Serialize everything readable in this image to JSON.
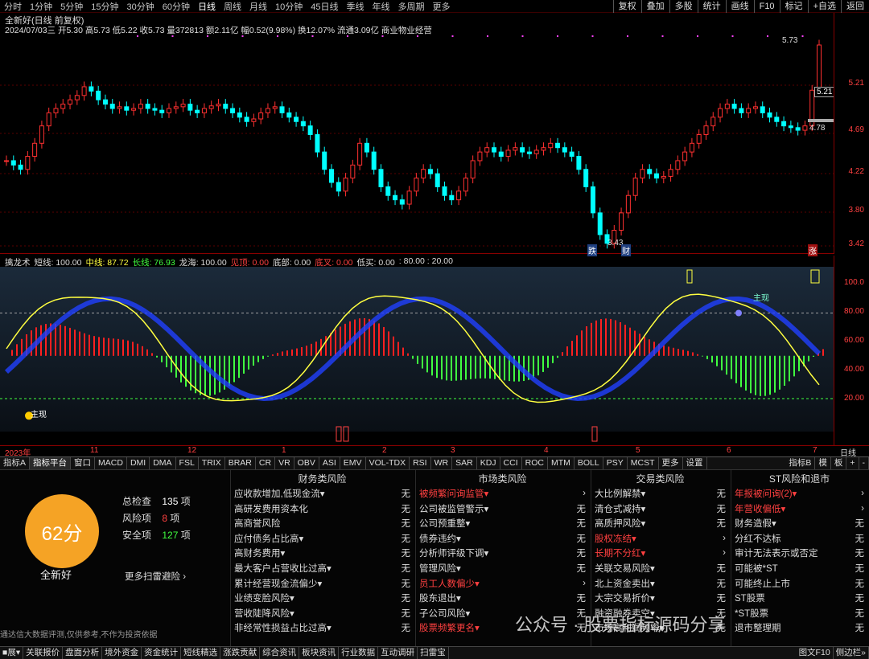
{
  "period_bar": {
    "items": [
      "分时",
      "1分钟",
      "5分钟",
      "15分钟",
      "30分钟",
      "60分钟",
      "日线",
      "周线",
      "月线",
      "10分钟",
      "45日线",
      "季线",
      "年线",
      "多周期",
      "更多"
    ],
    "active_index": 6,
    "right_buttons": [
      "复权",
      "叠加",
      "多股",
      "统计",
      "画线",
      "F10",
      "标记",
      "+自选",
      "返回"
    ]
  },
  "main_title": {
    "name": "全新好(日线 前复权)",
    "quote_line": "2024/07/03三 开5.30 高5.73 低5.22 收5.73 量372813 额2.11亿 幅0.52(9.98%) 换12.07% 流通3.09亿 商业物业经营",
    "price_high_label": "5.73",
    "price_last_label": "5.21",
    "price_mark_label": "4.78",
    "price_low_label": "3.43",
    "ma_tag": "财",
    "low_tag": "跌",
    "zhang_tag": "涨"
  },
  "main_yaxis": [
    "5.21",
    "4.69",
    "4.22",
    "3.80",
    "3.42"
  ],
  "ind_title": {
    "name": "擒龙术",
    "short": "短线: 100.00",
    "mid": "中线: 87.72",
    "long": "长线: 76.93",
    "dragon": "龙海: 100.00",
    "see_top": "见顶: 0.00",
    "bottom": "底部: 0.00",
    "bottom_cross": "底叉: 0.00",
    "low_buy": "低买: 0.00",
    "levels": ": 80.00 : 20.00"
  },
  "ind_labels": {
    "start": "主现",
    "mark2": "主现"
  },
  "ind_yaxis": [
    "100.0",
    "80.00",
    "60.00",
    "40.00",
    "20.00"
  ],
  "date_axis": [
    "2023年",
    "11",
    "12",
    "1",
    "2",
    "3",
    "4",
    "5",
    "6",
    "7",
    "日线"
  ],
  "tabs": [
    "指标A",
    "指标平台",
    "窗口",
    "MACD",
    "DMI",
    "DMA",
    "FSL",
    "TRIX",
    "BRAR",
    "CR",
    "VR",
    "OBV",
    "ASI",
    "EMV",
    "VOL-TDX",
    "RSI",
    "WR",
    "SAR",
    "KDJ",
    "CCI",
    "ROC",
    "MTM",
    "BOLL",
    "PSY",
    "MCST",
    "更多",
    "设置"
  ],
  "tabs_right": [
    "指标B",
    "模",
    "板",
    "+",
    "-"
  ],
  "scan": {
    "score": "62分",
    "stock_name": "全新好",
    "total_label": "总检查",
    "total_value": "135",
    "risk_label": "风险项",
    "risk_value": "8",
    "safe_label": "安全项",
    "safe_value": "127",
    "unit": "项",
    "more": "更多扫雷避险 ›",
    "disclaimer": "通达信大数据评测,仅供参考,不作为投资依据"
  },
  "columns": [
    {
      "title": "财务类风险",
      "rows": [
        {
          "label": "应收款增加,低现金流▾",
          "val": "无",
          "warn": false
        },
        {
          "label": "高研发费用资本化",
          "val": "无",
          "warn": false
        },
        {
          "label": "高商誉风险",
          "val": "无",
          "warn": false
        },
        {
          "label": "应付债务占比高▾",
          "val": "无",
          "warn": false
        },
        {
          "label": "高财务费用▾",
          "val": "无",
          "warn": false
        },
        {
          "label": "最大客户占营收比过高▾",
          "val": "无",
          "warn": false
        },
        {
          "label": "累计经营现金流偏少▾",
          "val": "无",
          "warn": false
        },
        {
          "label": "业绩变脸风险▾",
          "val": "无",
          "warn": false
        },
        {
          "label": "营收陡降风险▾",
          "val": "无",
          "warn": false
        },
        {
          "label": "非经常性损益占比过高▾",
          "val": "无",
          "warn": false
        }
      ]
    },
    {
      "title": "市场类风险",
      "rows": [
        {
          "label": "被频繁问询监管▾",
          "val": "›",
          "warn": true
        },
        {
          "label": "公司被监管警示▾",
          "val": "无",
          "warn": false
        },
        {
          "label": "公司预重整▾",
          "val": "无",
          "warn": false
        },
        {
          "label": "债券违约▾",
          "val": "无",
          "warn": false
        },
        {
          "label": "分析师评级下调▾",
          "val": "无",
          "warn": false
        },
        {
          "label": "管理风险▾",
          "val": "无",
          "warn": false
        },
        {
          "label": "员工人数偏少▾",
          "val": "›",
          "warn": true
        },
        {
          "label": "股东退出▾",
          "val": "无",
          "warn": false
        },
        {
          "label": "子公司风险▾",
          "val": "无",
          "warn": false
        },
        {
          "label": "股票频繁更名▾",
          "val": "无",
          "warn": true
        }
      ]
    },
    {
      "title": "交易类风险",
      "rows": [
        {
          "label": "大比例解禁▾",
          "val": "无",
          "warn": false
        },
        {
          "label": "清仓式减持▾",
          "val": "无",
          "warn": false
        },
        {
          "label": "高质押风险▾",
          "val": "无",
          "warn": false
        },
        {
          "label": "股权冻结▾",
          "val": "›",
          "warn": true
        },
        {
          "label": "长期不分红▾",
          "val": "›",
          "warn": true
        },
        {
          "label": "关联交易风险▾",
          "val": "无",
          "warn": false
        },
        {
          "label": "北上资金卖出▾",
          "val": "无",
          "warn": false
        },
        {
          "label": "大宗交易折价▾",
          "val": "无",
          "warn": false
        },
        {
          "label": "融资融券卖空▾",
          "val": "无",
          "warn": false
        },
        {
          "label": "市场高利润频率▾",
          "val": "无",
          "warn": false
        }
      ]
    },
    {
      "title": "ST风险和退市",
      "rows": [
        {
          "label": "年报被问询(2)▾",
          "val": "›",
          "warn": true
        },
        {
          "label": "年营收偏低▾",
          "val": "›",
          "warn": true
        },
        {
          "label": "财务造假▾",
          "val": "无",
          "warn": false
        },
        {
          "label": "分红不达标",
          "val": "无",
          "warn": false
        },
        {
          "label": "审计无法表示或否定",
          "val": "无",
          "warn": false
        },
        {
          "label": "可能被*ST",
          "val": "无",
          "warn": false
        },
        {
          "label": "可能终止上市",
          "val": "无",
          "warn": false
        },
        {
          "label": "ST股票",
          "val": "无",
          "warn": false
        },
        {
          "label": "*ST股票",
          "val": "无",
          "warn": false
        },
        {
          "label": "退市整理期",
          "val": "无",
          "warn": false
        }
      ]
    }
  ],
  "statusbar": [
    "■展▾",
    "关联报价",
    "盘面分析",
    "境外资金",
    "资金统计",
    "短线精选",
    "涨跌贡献",
    "综合资讯",
    "板块资讯",
    "行业数据",
    "互动调研",
    "扫雷宝",
    "图文F10",
    "侧边栏»"
  ],
  "watermark": "公众号 · 股票指标源码分享",
  "colors": {
    "up": "#ff3030",
    "down": "#00ffff",
    "score": "#f5a325",
    "warn": "#ff4040"
  }
}
